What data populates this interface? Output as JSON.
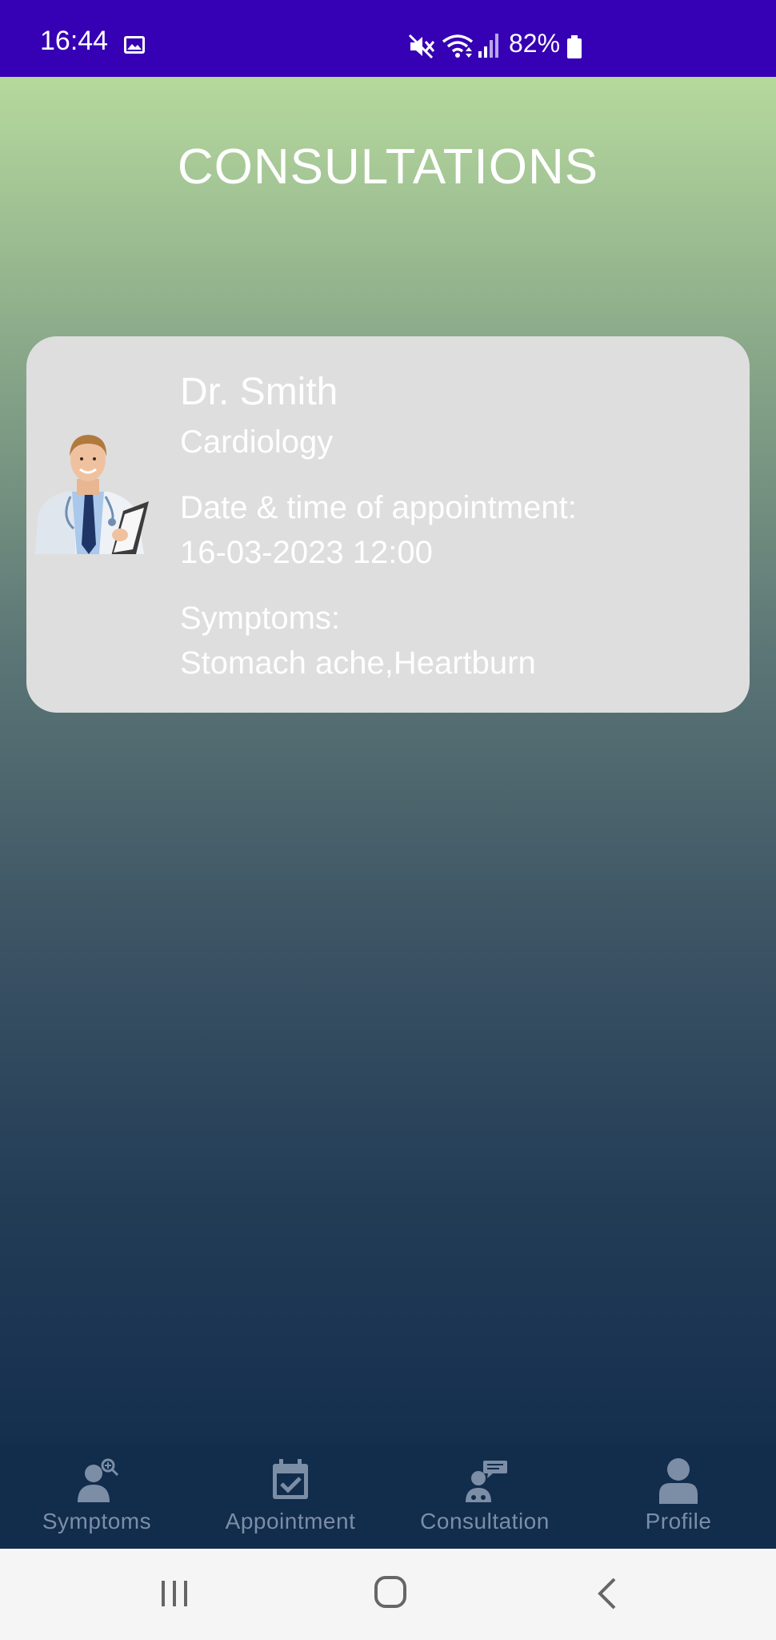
{
  "status_bar": {
    "time": "16:44",
    "battery": "82%",
    "background": "#3600b4",
    "icons": [
      "image-notification-icon",
      "mute-icon",
      "wifi-icon",
      "signal-icon",
      "battery-icon"
    ]
  },
  "page": {
    "title": "CONSULTATIONS"
  },
  "consultation": {
    "doctor_name": "Dr. Smith",
    "specialty": "Cardiology",
    "appointment_label": "Date & time of appointment:",
    "appointment_value": "16-03-2023 12:00",
    "symptoms_label": "Symptoms:",
    "symptoms_value": "Stomach ache,Heartburn",
    "card_color": "#dedede"
  },
  "bottom_nav": {
    "items": [
      {
        "label": "Symptoms",
        "icon": "person-search-icon"
      },
      {
        "label": "Appointment",
        "icon": "calendar-check-icon"
      },
      {
        "label": "Consultation",
        "icon": "doctor-chat-icon"
      },
      {
        "label": "Profile",
        "icon": "person-icon"
      }
    ],
    "background": "#122c4c",
    "item_color": "#7c8ea6"
  },
  "system_nav": {
    "icons": [
      "recents-icon",
      "home-icon",
      "back-icon"
    ]
  }
}
